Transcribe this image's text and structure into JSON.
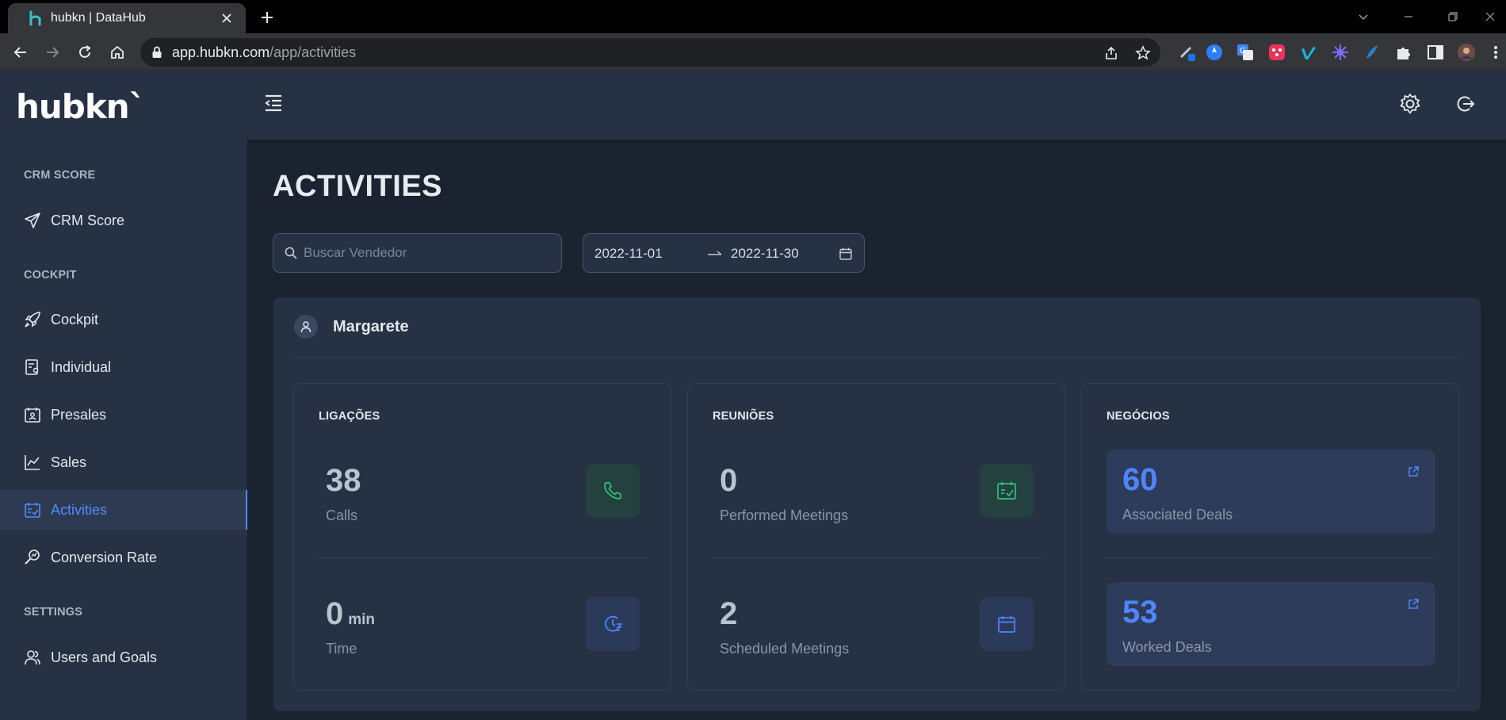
{
  "browser": {
    "tab_title": "hubkn | DataHub",
    "url_host": "app.hubkn.com",
    "url_path": "/app/activities"
  },
  "app": {
    "logo": "hubkn`"
  },
  "sidebar": {
    "sections": [
      {
        "label": "CRM SCORE"
      },
      {
        "label": "COCKPIT"
      },
      {
        "label": "SETTINGS"
      }
    ],
    "items": [
      {
        "label": "CRM Score",
        "icon": "send-icon"
      },
      {
        "label": "Cockpit",
        "icon": "rocket-icon"
      },
      {
        "label": "Individual",
        "icon": "document-user-icon"
      },
      {
        "label": "Presales",
        "icon": "calendar-user-icon"
      },
      {
        "label": "Sales",
        "icon": "line-chart-icon"
      },
      {
        "label": "Activities",
        "icon": "calendar-check-icon",
        "active": true
      },
      {
        "label": "Conversion Rate",
        "icon": "search-chart-icon"
      },
      {
        "label": "Users and Goals",
        "icon": "users-icon"
      }
    ]
  },
  "main": {
    "title": "ACTIVITIES",
    "search_placeholder": "Buscar Vendedor",
    "date_start": "2022-11-01",
    "date_end": "2022-11-30",
    "user_name": "Margarete"
  },
  "cards": {
    "calls": {
      "title": "LIGAÇÕES",
      "count": "38",
      "count_label": "Calls",
      "time": "0",
      "time_unit": "min",
      "time_label": "Time"
    },
    "meetings": {
      "title": "REUNIÕES",
      "performed": "0",
      "performed_label": "Performed Meetings",
      "scheduled": "2",
      "scheduled_label": "Scheduled Meetings"
    },
    "deals": {
      "title": "NEGÓCIOS",
      "associated": "60",
      "associated_label": "Associated Deals",
      "worked": "53",
      "worked_label": "Worked Deals"
    }
  },
  "colors": {
    "accent": "#4f8cff",
    "green_icon": "#2fc27a",
    "background": "#1b2330",
    "surface": "#263143"
  }
}
